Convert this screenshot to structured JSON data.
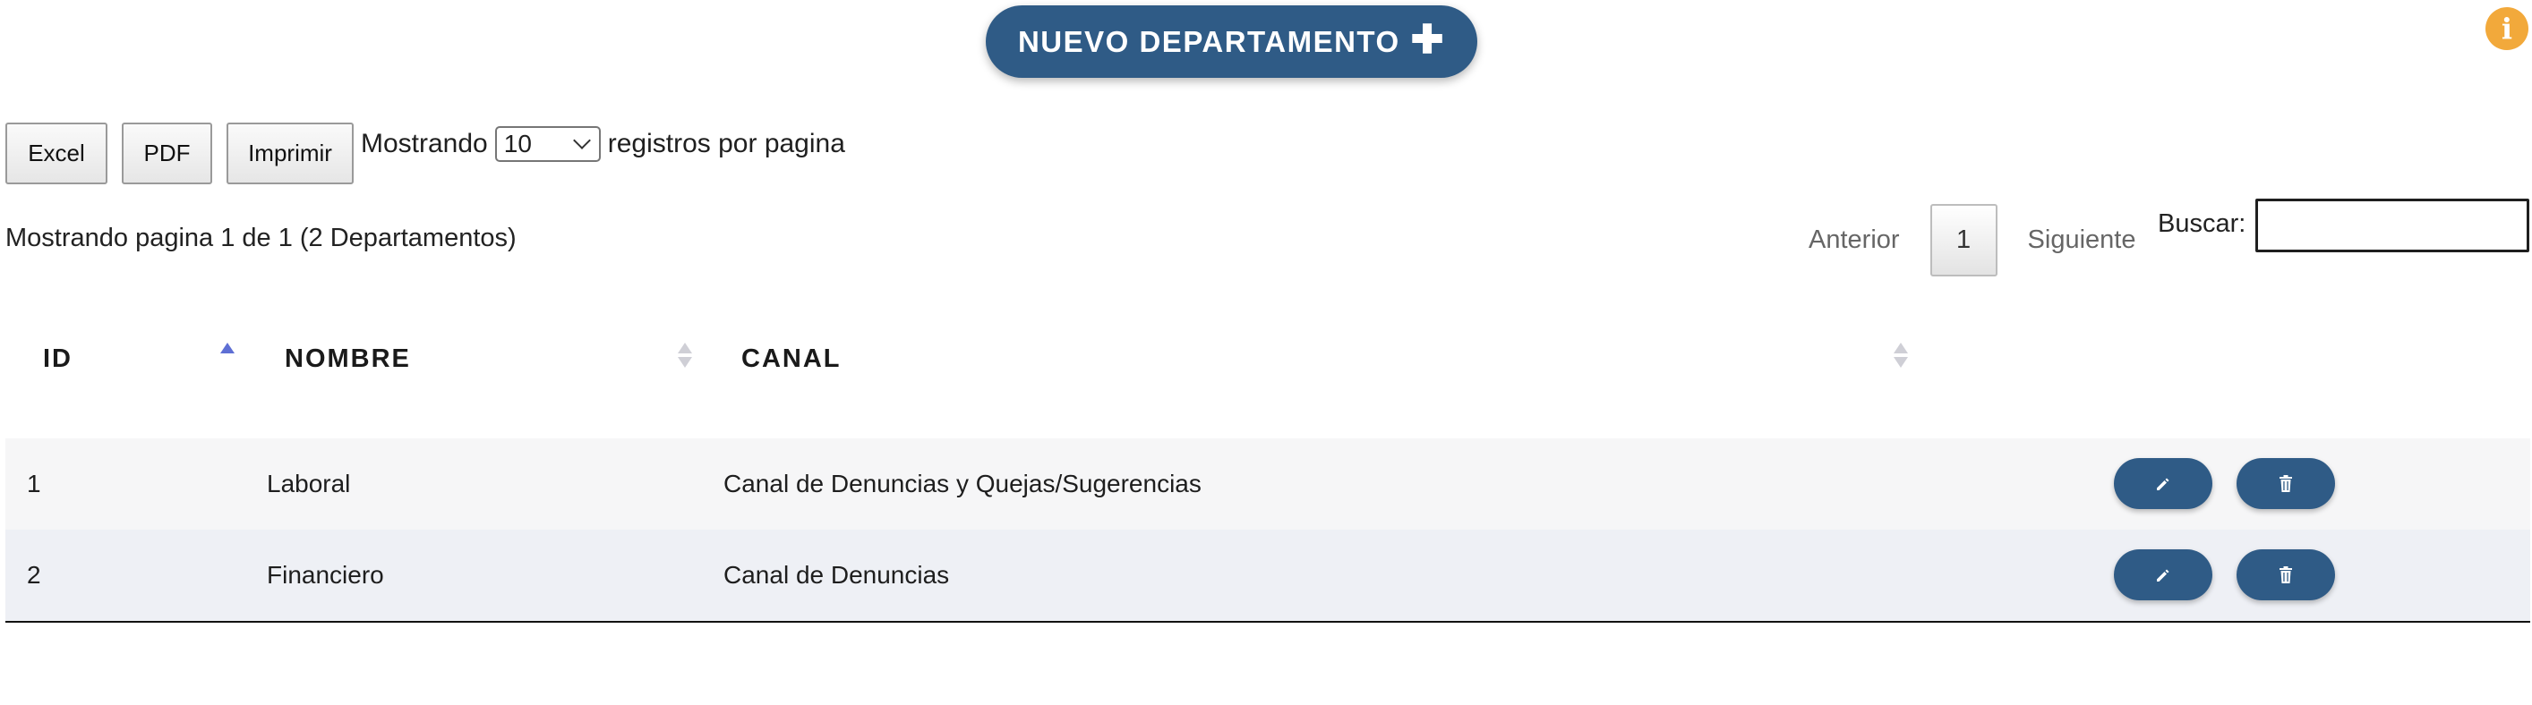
{
  "header": {
    "new_button_label": "NUEVO DEPARTAMENTO",
    "new_button_icon": "plus-icon",
    "info_icon": "info-icon"
  },
  "export": {
    "excel": "Excel",
    "pdf": "PDF",
    "print": "Imprimir"
  },
  "length": {
    "prefix": "Mostrando",
    "value": "10",
    "suffix": "registros por pagina"
  },
  "info": "Mostrando pagina 1 de 1 (2 Departamentos)",
  "pagination": {
    "prev": "Anterior",
    "current": "1",
    "next": "Siguiente"
  },
  "search": {
    "label": "Buscar:",
    "value": ""
  },
  "table": {
    "columns": [
      "ID",
      "NOMBRE",
      "CANAL"
    ],
    "sort": {
      "column": "ID",
      "direction": "asc"
    },
    "rows": [
      {
        "id": "1",
        "nombre": "Laboral",
        "canal": "Canal de Denuncias y Quejas/Sugerencias"
      },
      {
        "id": "2",
        "nombre": "Financiero",
        "canal": "Canal de Denuncias"
      }
    ],
    "row_actions": [
      "edit-icon",
      "trash-icon"
    ]
  },
  "colors": {
    "primary": "#2f5b86",
    "info": "#f2a93b",
    "sort_active": "#5e6fd4"
  }
}
